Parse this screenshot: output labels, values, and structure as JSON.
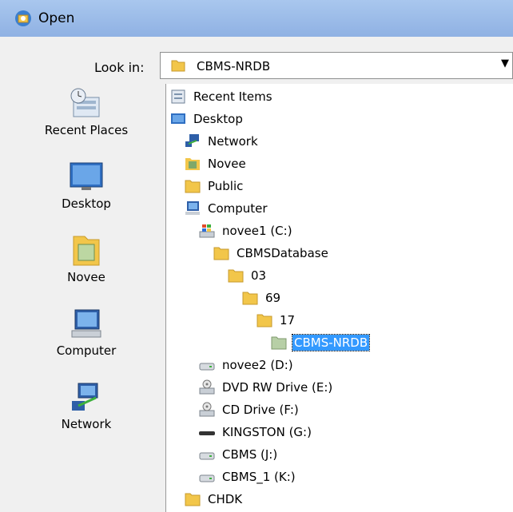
{
  "window": {
    "title": "Open"
  },
  "lookin": {
    "label": "Look in:",
    "value": "CBMS-NRDB"
  },
  "places": [
    {
      "label": "Recent Places",
      "icon": "recent-places-icon"
    },
    {
      "label": "Desktop",
      "icon": "desktop-icon"
    },
    {
      "label": "Novee",
      "icon": "user-folder-icon"
    },
    {
      "label": "Computer",
      "icon": "computer-icon"
    },
    {
      "label": "Network",
      "icon": "network-icon"
    }
  ],
  "tree": [
    {
      "label": "Recent Items",
      "icon": "recent-items-icon",
      "level": 0
    },
    {
      "label": "Desktop",
      "icon": "desktop-icon",
      "level": 0
    },
    {
      "label": "Network",
      "icon": "network-icon",
      "level": 1
    },
    {
      "label": "Novee",
      "icon": "user-folder-icon",
      "level": 1
    },
    {
      "label": "Public",
      "icon": "folder-icon",
      "level": 1
    },
    {
      "label": "Computer",
      "icon": "computer-icon",
      "level": 1
    },
    {
      "label": "novee1 (C:)",
      "icon": "windows-drive-icon",
      "level": 2
    },
    {
      "label": "CBMSDatabase",
      "icon": "folder-icon",
      "level": 3
    },
    {
      "label": "03",
      "icon": "folder-icon",
      "level": 4
    },
    {
      "label": "69",
      "icon": "folder-icon",
      "level": 5
    },
    {
      "label": "17",
      "icon": "folder-icon",
      "level": 6
    },
    {
      "label": "CBMS-NRDB",
      "icon": "folder-open-icon",
      "level": 7,
      "selected": true
    },
    {
      "label": "novee2 (D:)",
      "icon": "hard-drive-icon",
      "level": 2
    },
    {
      "label": "DVD RW Drive (E:)",
      "icon": "dvd-drive-icon",
      "level": 2
    },
    {
      "label": "CD Drive (F:)",
      "icon": "cd-drive-icon",
      "level": 2
    },
    {
      "label": "KINGSTON (G:)",
      "icon": "usb-drive-icon",
      "level": 2
    },
    {
      "label": "CBMS (J:)",
      "icon": "hard-drive-icon",
      "level": 2
    },
    {
      "label": "CBMS_1 (K:)",
      "icon": "hard-drive-icon",
      "level": 2
    },
    {
      "label": "CHDK",
      "icon": "folder-icon",
      "level": 1
    }
  ],
  "colors": {
    "selection": "#3399ff",
    "folder": "#f2c64a",
    "titlebar": "#8fb1e3"
  }
}
